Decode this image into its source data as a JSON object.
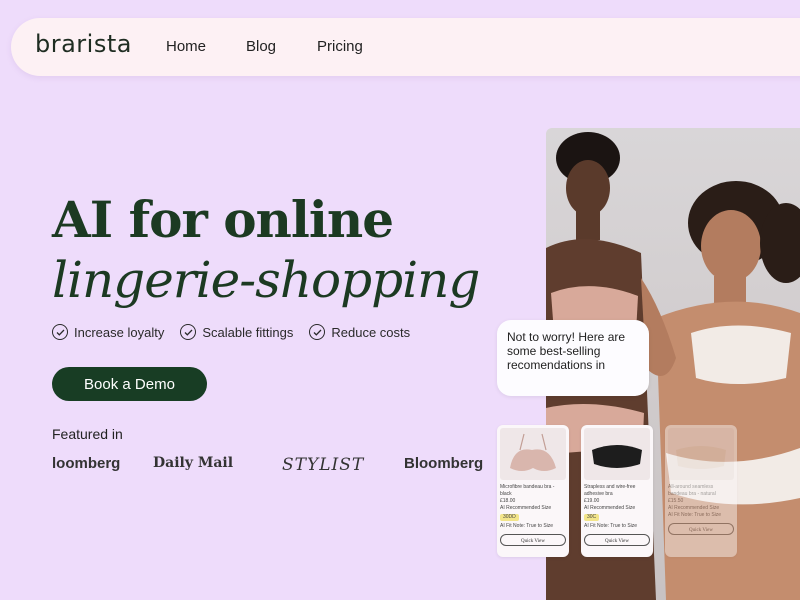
{
  "nav": {
    "logo": "brarista",
    "links": [
      "Home",
      "Blog",
      "Pricing"
    ]
  },
  "hero": {
    "title_line1": "AI for online",
    "title_line2": "lingerie-shopping",
    "features": [
      "Increase loyalty",
      "Scalable fittings",
      "Reduce costs"
    ],
    "cta_label": "Book a Demo"
  },
  "featured": {
    "label": "Featured in",
    "logos": [
      "loomberg",
      "Daily Mail",
      "STYLIST",
      "Bloomberg"
    ]
  },
  "chat": {
    "bubble_text": "Not to worry! Here are some best-selling recomendations in"
  },
  "products": [
    {
      "name": "Microfibre bandeau bra - black",
      "price": "£18.00",
      "rec_label": "AI Recommended Size",
      "size": "30DD",
      "fit_note": "AI Fit Note: True to Size",
      "button": "Quick View"
    },
    {
      "name": "Strapless and wire-free adhesive bra",
      "price": "£19.00",
      "rec_label": "AI Recommended Size",
      "size": "30C",
      "fit_note": "AI Fit Note: True to Size",
      "button": "Quick View"
    },
    {
      "name": "All-around seamless bandeau bra - natural",
      "price": "£15.50",
      "rec_label": "AI Recommended Size",
      "size": "",
      "fit_note": "AI Fit Note: True to Size",
      "button": "Quick View"
    }
  ],
  "colors": {
    "background": "#eedcfb",
    "nav_bg": "#fdf1f4",
    "primary_dark_green": "#183d24",
    "heading_green": "#1c3a22",
    "size_badge": "#f3e58a"
  },
  "icons": [
    "check-circle-icon"
  ]
}
